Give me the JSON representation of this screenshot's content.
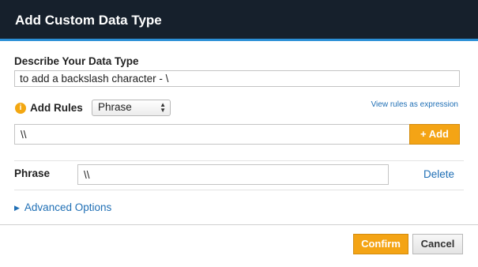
{
  "dialog": {
    "title": "Add Custom Data Type"
  },
  "describe": {
    "label": "Describe Your Data Type",
    "value": "to add a backslash character - \\"
  },
  "rules": {
    "label": "Add Rules",
    "info_icon": "info-icon",
    "type_selected": "Phrase",
    "view_link": "View rules as expression",
    "rule_input_value": "\\\\",
    "add_button": "+ Add"
  },
  "phrase_rule": {
    "label": "Phrase",
    "value": "\\\\",
    "delete_link": "Delete"
  },
  "advanced": {
    "label": "Advanced Options"
  },
  "footer": {
    "confirm": "Confirm",
    "cancel": "Cancel"
  },
  "colors": {
    "titlebar": "#16202c",
    "accent_line": "#2b8fd6",
    "primary_button": "#f4a415",
    "link": "#1f6fb5"
  }
}
